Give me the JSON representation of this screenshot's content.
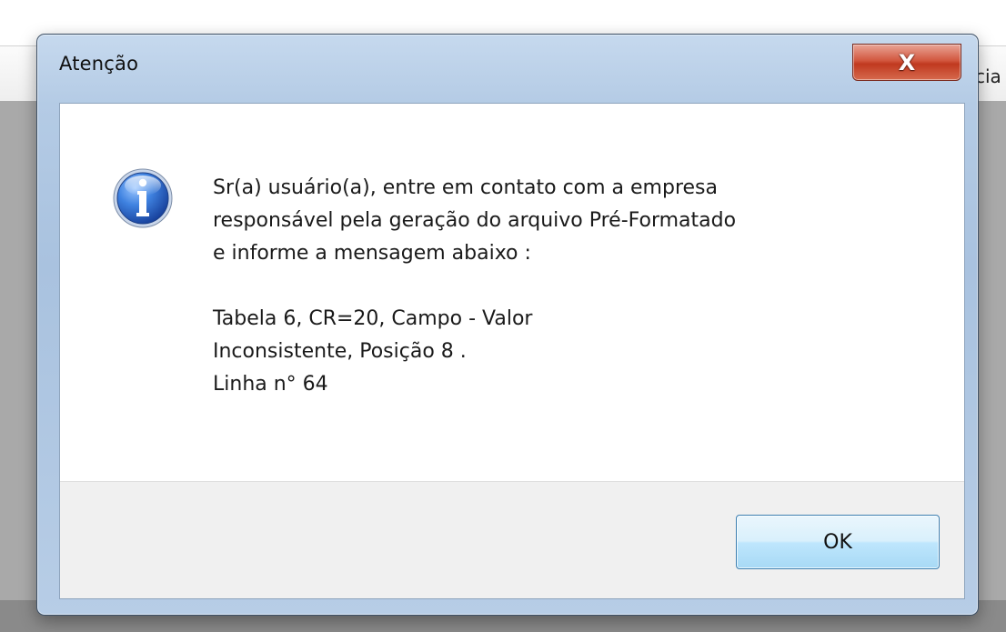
{
  "background": {
    "partial_label": "cia"
  },
  "dialog": {
    "title": "Atenção",
    "close_glyph": "X",
    "icon": "information-icon",
    "message": {
      "lines": [
        "Sr(a) usuário(a), entre em contato com a empresa",
        "responsável pela geração do arquivo Pré-Formatado",
        "e informe a mensagem abaixo :"
      ],
      "detail_lines": [
        "Tabela 6, CR=20, Campo - Valor",
        "Inconsistente,  Posição 8 .",
        "Linha n° 64"
      ]
    },
    "ok_label": "OK"
  },
  "colors": {
    "frame": "#b4cbe5",
    "close_button": "#c0391f",
    "ok_button": "#bee6fd",
    "info_icon": "#2f6fd0"
  }
}
